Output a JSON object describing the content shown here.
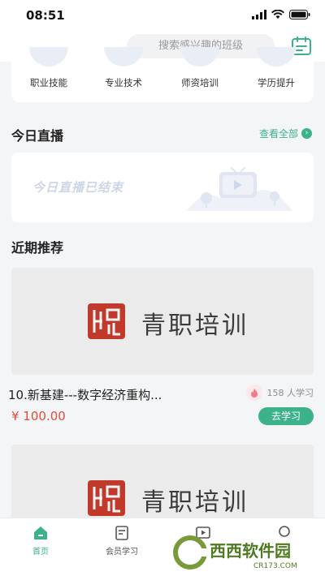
{
  "status": {
    "time": "08:51"
  },
  "search": {
    "placeholder": "搜索感兴趣的班级",
    "calendar_icon": "calendar-icon"
  },
  "categories": [
    {
      "label": "职业技能"
    },
    {
      "label": "专业技术"
    },
    {
      "label": "师资培训"
    },
    {
      "label": "学历提升"
    }
  ],
  "live": {
    "title": "今日直播",
    "see_all": "查看全部",
    "ended_text": "今日直播已结束"
  },
  "recommend": {
    "title": "近期推荐",
    "courses": [
      {
        "banner_text": "青职培训",
        "title": "10.新基建---数字经济重构...",
        "learners": "158 人学习",
        "price": "¥ 100.00",
        "cta": "去学习"
      },
      {
        "banner_text": "青职培训"
      }
    ]
  },
  "tabs": [
    {
      "label": "首页",
      "active": true
    },
    {
      "label": "会员学习",
      "active": false
    },
    {
      "label": "",
      "active": false
    },
    {
      "label": "",
      "active": false
    }
  ],
  "watermark": {
    "name": "西西软件园",
    "url": "CR173.COM"
  },
  "colors": {
    "accent": "#3bb28a",
    "price": "#e24a3b",
    "seal": "#c0392b"
  }
}
